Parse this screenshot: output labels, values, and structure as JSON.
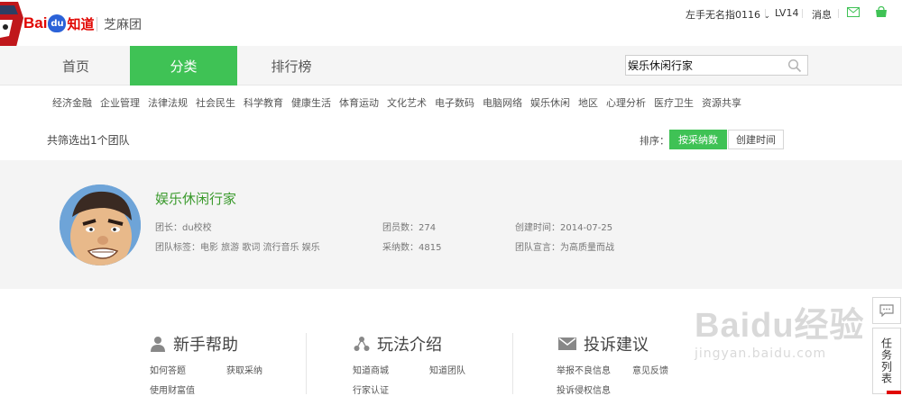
{
  "header": {
    "logo_bai": "Bai",
    "logo_du": "du",
    "logo_zhidao": "知道",
    "sub_brand": "芝麻团",
    "username": "左手无名指0116",
    "level": "LV14",
    "messages": "消息"
  },
  "nav": {
    "tabs": [
      "首页",
      "分类",
      "排行榜"
    ],
    "active_tab": "分类",
    "search_value": "娱乐休闲行家"
  },
  "categories": [
    "经济金融",
    "企业管理",
    "法律法规",
    "社会民生",
    "科学教育",
    "健康生活",
    "体育运动",
    "文化艺术",
    "电子数码",
    "电脑网络",
    "娱乐休闲",
    "地区",
    "心理分析",
    "医疗卫生",
    "资源共享"
  ],
  "results": {
    "text": "共筛选出1个团队",
    "sort_label": "排序：",
    "sort_options": [
      "按采纳数",
      "创建时间"
    ]
  },
  "team": {
    "name": "娱乐休闲行家",
    "leader": "团长：du校校",
    "members": "团员数：274",
    "created": "创建时间：2014-07-25",
    "tags": "团队标签：电影 旅游 歌词 流行音乐 娱乐",
    "adopted": "采纳数：4815",
    "motto": "团队宣言：为高质量而战"
  },
  "help": {
    "sections": [
      {
        "title": "新手帮助",
        "icon": "user-icon",
        "links": [
          "如何答题",
          "获取采纳",
          "使用财富值"
        ]
      },
      {
        "title": "玩法介绍",
        "icon": "share-icon",
        "links": [
          "知道商城",
          "知道团队",
          "行家认证"
        ]
      },
      {
        "title": "投诉建议",
        "icon": "mail-icon",
        "links": [
          "举报不良信息",
          "意见反馈",
          "投诉侵权信息"
        ]
      }
    ]
  },
  "side": {
    "task_list": "任务列表"
  },
  "watermark": {
    "text": "Baidu经验",
    "url": "jingyan.baidu.com"
  },
  "colors": {
    "accent_green": "#3fc255",
    "team_name_green": "#3a9a2c",
    "baidu_red": "#e10602",
    "baidu_blue": "#2b62d8"
  }
}
